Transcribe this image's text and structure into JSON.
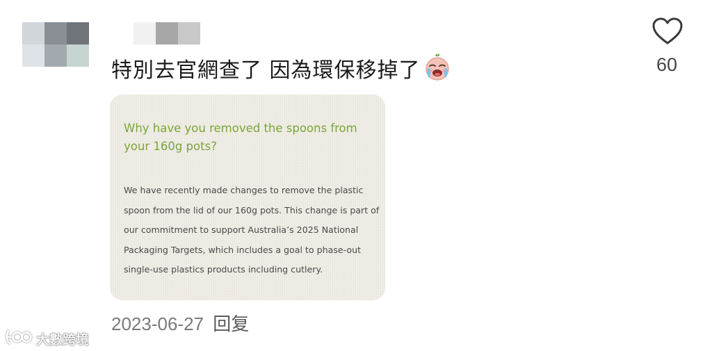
{
  "comment": {
    "text": "特別去官網查了 因為環保移掉了",
    "emoji_icon": "loudly-crying-face-emoji",
    "date": "2023-06-27",
    "reply_label": "回复",
    "like_icon": "heart-outline-icon",
    "like_count": "60"
  },
  "attached_image": {
    "question": "Why have you removed the spoons from your 160g pots?",
    "answer": "We have recently made changes to remove the plastic spoon from the lid of our 160g pots. This change is part of our commitment to support Australia’s 2025 National Packaging Targets, which includes a goal to phase-out single-use plastics products including cutlery.",
    "question_color": "#78a53a"
  },
  "avatar": {
    "pixel_colors": [
      "#d2d6da",
      "#8a8f96",
      "#6f7479",
      "#dde3e6",
      "#a3aaaf",
      "#c6d4d2"
    ]
  },
  "username": {
    "pixel_colors": [
      "#f1f1f1",
      "#a7a7a7",
      "#c8c8c8"
    ]
  },
  "watermark": {
    "text": "大數跨境",
    "icon": "brand-logo-icon"
  }
}
